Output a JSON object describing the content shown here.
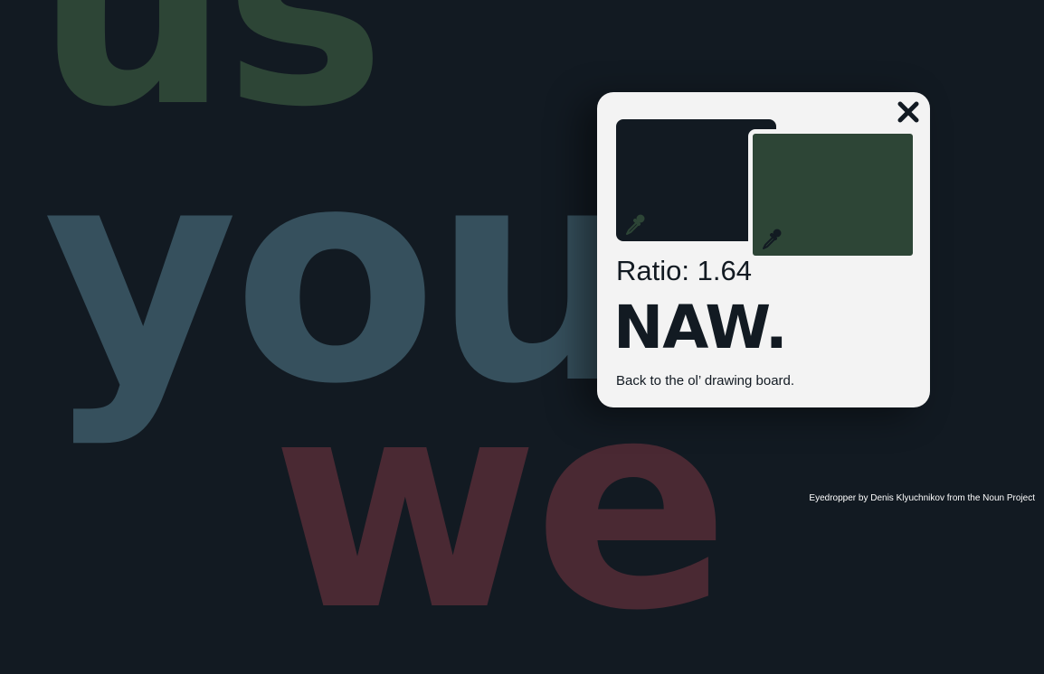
{
  "background_words": {
    "word_1": {
      "text": "us",
      "color": "#2d4536"
    },
    "word_2": {
      "text": "you",
      "color": "#36505d"
    },
    "word_3": {
      "text": "we",
      "color": "#4a2933"
    }
  },
  "modal": {
    "background_color": "#f3f3f3",
    "close_icon": "close-icon",
    "swatches": [
      {
        "color": "#121a22",
        "icon": "eyedropper-icon",
        "icon_color": "#2d4536"
      },
      {
        "color": "#2d4536",
        "icon": "eyedropper-icon",
        "icon_color": "#121a22"
      }
    ],
    "ratio_text": "Ratio: 1.64",
    "verdict": "NAW.",
    "message": "Back to the ol’ drawing board."
  },
  "credit": "Eyedropper by Denis Klyuchnikov from the Noun Project"
}
